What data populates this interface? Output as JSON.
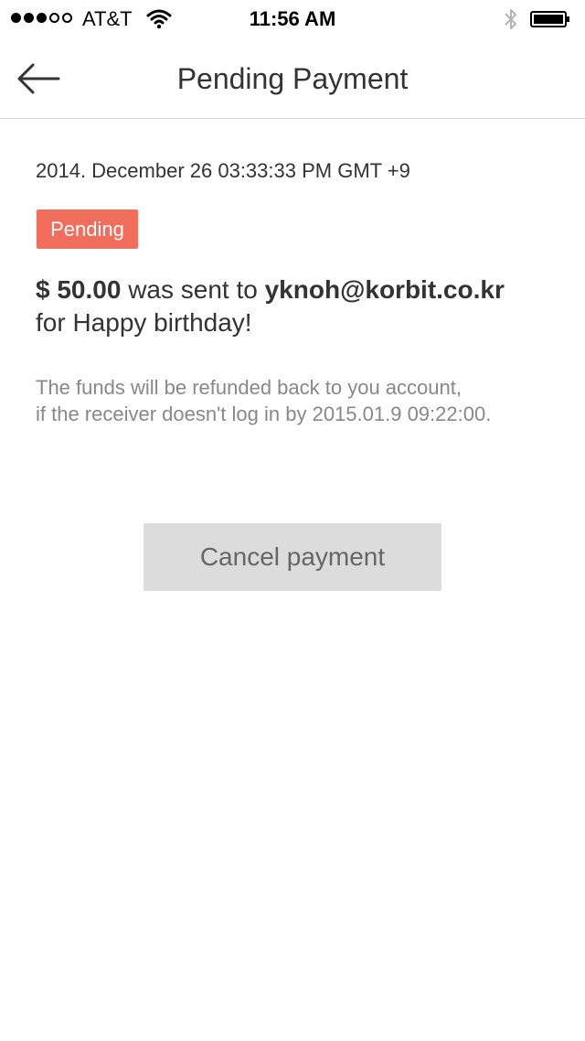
{
  "status_bar": {
    "carrier": "AT&T",
    "time": "11:56 AM",
    "signal_bars": 3,
    "signal_total": 5,
    "icons": [
      "wifi-icon",
      "bluetooth-icon",
      "battery-icon"
    ]
  },
  "nav": {
    "title": "Pending Payment",
    "back_icon": "arrow-left-icon"
  },
  "payment": {
    "timestamp": "2014. December 26 03:33:33 PM GMT +9",
    "status": "Pending",
    "status_color": "#f26e5c",
    "amount": "$ 50.00",
    "sent_to_text": " was sent to ",
    "recipient": "yknoh@korbit.co.kr",
    "memo": "for Happy birthday!",
    "refund_line1": "The funds will be refunded back to you account,",
    "refund_line2": "if the receiver doesn't log in by 2015.01.9 09:22:00."
  },
  "actions": {
    "cancel_label": "Cancel payment"
  }
}
